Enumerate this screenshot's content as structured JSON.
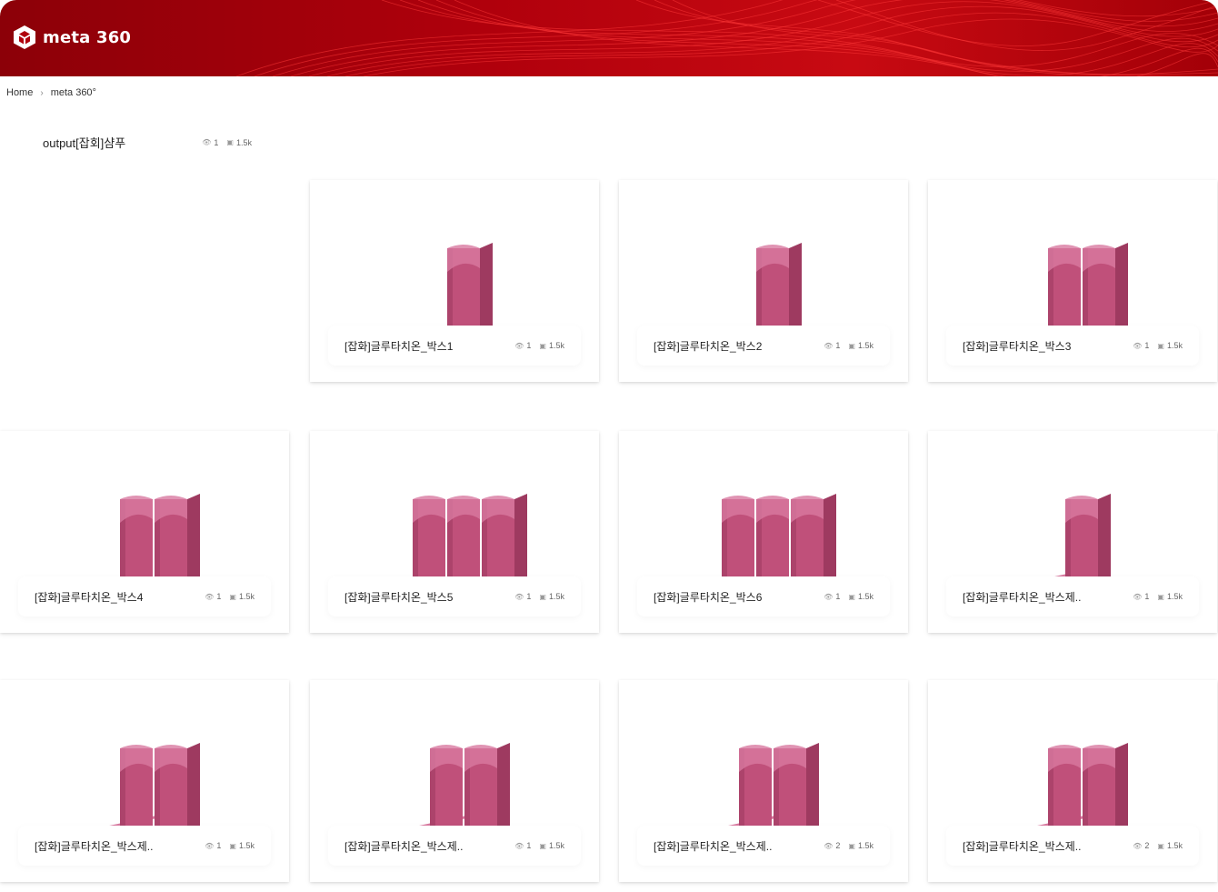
{
  "header": {
    "brand": "meta 360",
    "logo_icon": "cube-logo-icon",
    "banner_color": "#b0000c"
  },
  "breadcrumb": {
    "home": "Home",
    "current": "meta 360°"
  },
  "folder": {
    "title": "output[잡회]샴푸",
    "views": "1",
    "size": "1.5k"
  },
  "items": [
    {
      "label": "[잡화]글루타치온_박스1",
      "views": "1",
      "size": "1.5k",
      "boxes": 1
    },
    {
      "label": "[잡화]글루타치온_박스2",
      "views": "1",
      "size": "1.5k",
      "boxes": 1
    },
    {
      "label": "[잡화]글루타치온_박스3",
      "views": "1",
      "size": "1.5k",
      "boxes": 2
    },
    {
      "label": "[잡화]글루타치온_박스4",
      "views": "1",
      "size": "1.5k",
      "boxes": 2
    },
    {
      "label": "[잡화]글루타치온_박스5",
      "views": "1",
      "size": "1.5k",
      "boxes": 3
    },
    {
      "label": "[잡화]글루타치온_박스6",
      "views": "1",
      "size": "1.5k",
      "boxes": 3
    },
    {
      "label": "[잡화]글루타치온_박스제..",
      "views": "1",
      "size": "1.5k",
      "boxes": 1
    },
    {
      "label": "[잡화]글루타치온_박스제..",
      "views": "1",
      "size": "1.5k",
      "boxes": 2
    },
    {
      "label": "[잡화]글루타치온_박스제..",
      "views": "1",
      "size": "1.5k",
      "boxes": 2
    },
    {
      "label": "[잡화]글루타치온_박스제..",
      "views": "2",
      "size": "1.5k",
      "boxes": 2
    },
    {
      "label": "[잡화]글루타치온_박스제..",
      "views": "2",
      "size": "1.5k",
      "boxes": 2
    }
  ],
  "colors": {
    "product_pink": "#c0507a",
    "product_pink_dark": "#9e3a60",
    "product_pink_light": "#d879a0"
  }
}
